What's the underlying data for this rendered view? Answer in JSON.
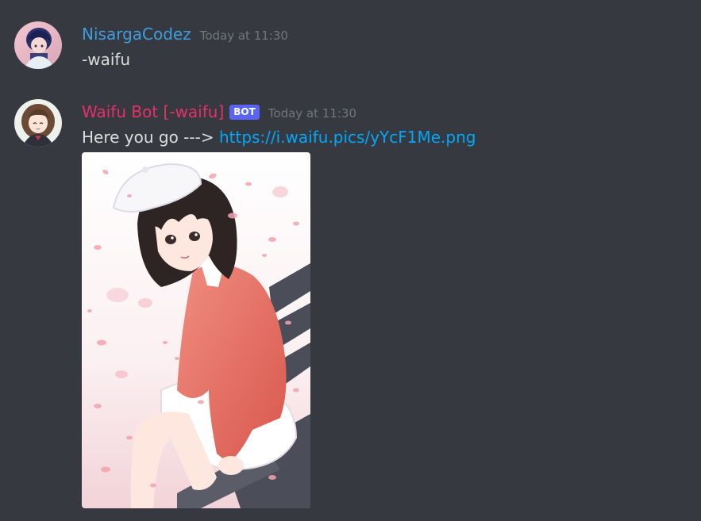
{
  "messages": [
    {
      "username": "NisargaCodez",
      "timestamp": "Today at 11:30",
      "content": "-waifu",
      "username_color": "#3c9ede"
    },
    {
      "username": "Waifu Bot [-waifu]",
      "bot_tag": "BOT",
      "timestamp": "Today at 11:30",
      "content_prefix": "Here you go --->",
      "link": "https://i.waifu.pics/yYcF1Me.png",
      "username_color": "#e5316a"
    }
  ],
  "colors": {
    "background": "#36393f",
    "text": "#dcddde",
    "timestamp": "#72767d",
    "link": "#00a8fc",
    "bot_tag": "#5865f2"
  }
}
